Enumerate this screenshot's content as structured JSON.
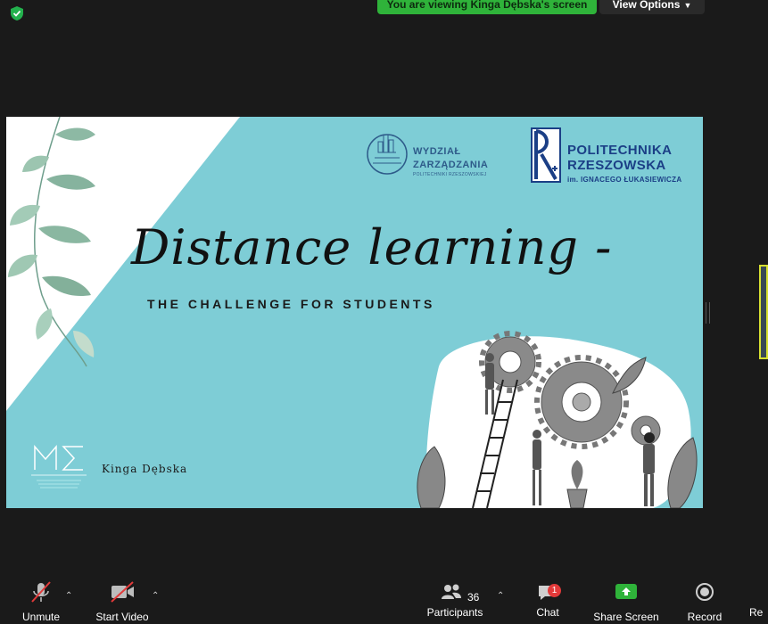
{
  "banner": {
    "text": "You are viewing Kinga Dębska's screen"
  },
  "view_options": {
    "label": "View Options"
  },
  "slide": {
    "faculty_logo": {
      "line1": "WYDZIAŁ",
      "line2": "ZARZĄDZANIA",
      "line3": "POLITECHNIKI RZESZOWSKIEJ"
    },
    "university_logo": {
      "line1": "POLITECHNIKA",
      "line2": "RZESZOWSKA",
      "line3": "im. IGNACEGO ŁUKASIEWICZA"
    },
    "title": "Distance learning -",
    "subtitle": "THE CHALLENGE FOR STUDENTS",
    "presenter": "Kinga Dębska",
    "colors": {
      "background": "#7ecdd6",
      "accent_blue": "#1b3f86"
    }
  },
  "toolbar": {
    "unmute": "Unmute",
    "start_video": "Start Video",
    "participants": "Participants",
    "participants_count": "36",
    "chat": "Chat",
    "chat_badge": "1",
    "share_screen": "Share Screen",
    "record": "Record",
    "reactions": "Re"
  },
  "icons": [
    "shield-icon",
    "microphone-muted-icon",
    "video-muted-icon",
    "participants-icon",
    "chat-icon",
    "share-screen-icon",
    "record-icon"
  ]
}
